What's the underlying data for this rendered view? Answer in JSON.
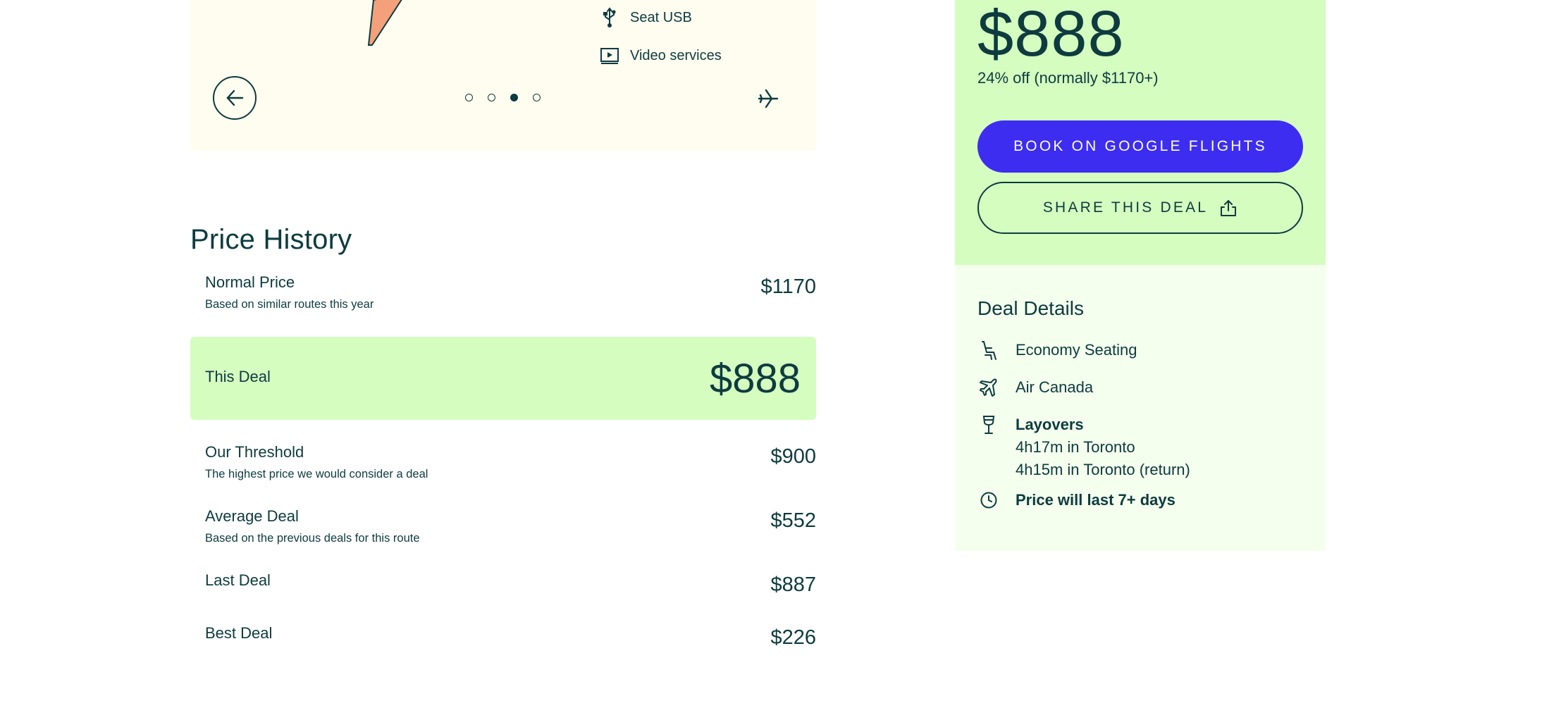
{
  "carousel": {
    "amenities": [
      {
        "icon": "usb-icon",
        "label": "Seat USB"
      },
      {
        "icon": "video-screen-icon",
        "label": "Video services"
      }
    ],
    "dots": 4,
    "active_dot": 3
  },
  "price_history": {
    "title": "Price History",
    "normal_price": {
      "label": "Normal Price",
      "sub": "Based on similar routes this year",
      "price": "$1170"
    },
    "this_deal": {
      "label": "This Deal",
      "price": "$888"
    },
    "threshold": {
      "label": "Our Threshold",
      "sub": "The highest price we would consider a deal",
      "price": "$900"
    },
    "average_deal": {
      "label": "Average Deal",
      "sub": "Based on the previous deals for this route",
      "price": "$552"
    },
    "last_deal": {
      "label": "Last Deal",
      "price": "$887"
    },
    "best_deal": {
      "label": "Best Deal",
      "price": "$226"
    }
  },
  "deal": {
    "price": "$888",
    "discount": "24% off (normally $1170+)",
    "book_label": "BOOK ON GOOGLE FLIGHTS",
    "share_label": "SHARE THIS DEAL"
  },
  "details": {
    "title": "Deal Details",
    "seating": "Economy Seating",
    "airline": "Air Canada",
    "layovers_title": "Layovers",
    "layover_out": "4h17m in Toronto",
    "layover_return": "4h15m in Toronto (return)",
    "duration": "Price will last 7+ days"
  },
  "colors": {
    "text": "#0d3b3f",
    "accent": "#3d2df0",
    "deal_green": "#d5fdc0",
    "details_bg": "#f4ffed",
    "card_bg": "#fefdef"
  }
}
